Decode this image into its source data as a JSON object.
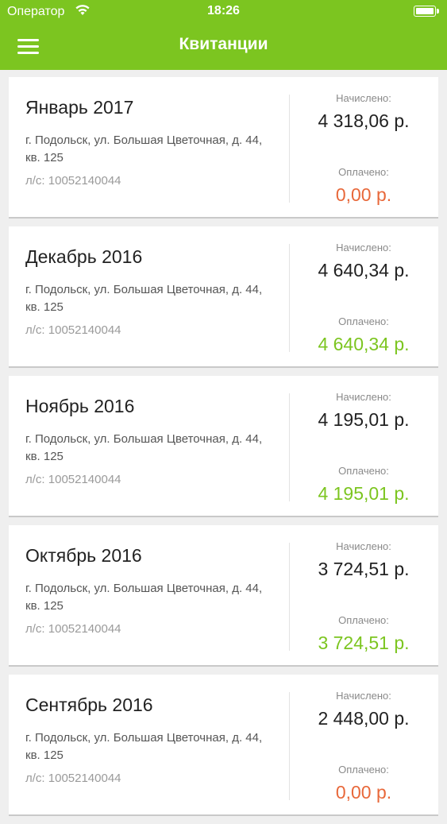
{
  "status_bar": {
    "carrier": "Оператор",
    "time": "18:26",
    "wifi_icon": "wifi-icon",
    "battery_icon": "battery-icon"
  },
  "header": {
    "title": "Квитанции",
    "menu_icon": "hamburger-menu-icon"
  },
  "colors": {
    "accent": "#7cc520",
    "paid_ok": "#7cc520",
    "paid_zero": "#e8683a",
    "background": "#efefef"
  },
  "receipts": [
    {
      "month": "Январь 2017",
      "address": "г. Подольск, ул. Большая Цветочная, д. 44, кв. 125",
      "account": "л/с: 10052140044",
      "charged_label": "Начислено:",
      "charged": "4 318,06 р.",
      "paid_label": "Оплачено:",
      "paid": "0,00 р.",
      "paid_status": "zero"
    },
    {
      "month": "Декабрь 2016",
      "address": "г. Подольск, ул. Большая Цветочная, д. 44, кв. 125",
      "account": "л/с: 10052140044",
      "charged_label": "Начислено:",
      "charged": "4 640,34 р.",
      "paid_label": "Оплачено:",
      "paid": "4 640,34 р.",
      "paid_status": "ok"
    },
    {
      "month": "Ноябрь 2016",
      "address": "г. Подольск, ул. Большая Цветочная, д. 44, кв. 125",
      "account": "л/с: 10052140044",
      "charged_label": "Начислено:",
      "charged": "4 195,01 р.",
      "paid_label": "Оплачено:",
      "paid": "4 195,01 р.",
      "paid_status": "ok"
    },
    {
      "month": "Октябрь 2016",
      "address": "г. Подольск, ул. Большая Цветочная, д. 44, кв. 125",
      "account": "л/с: 10052140044",
      "charged_label": "Начислено:",
      "charged": "3 724,51 р.",
      "paid_label": "Оплачено:",
      "paid": "3 724,51 р.",
      "paid_status": "ok"
    },
    {
      "month": "Сентябрь 2016",
      "address": "г. Подольск, ул. Большая Цветочная, д. 44, кв. 125",
      "account": "л/с: 10052140044",
      "charged_label": "Начислено:",
      "charged": "2 448,00 р.",
      "paid_label": "Оплачено:",
      "paid": "0,00 р.",
      "paid_status": "zero"
    }
  ]
}
